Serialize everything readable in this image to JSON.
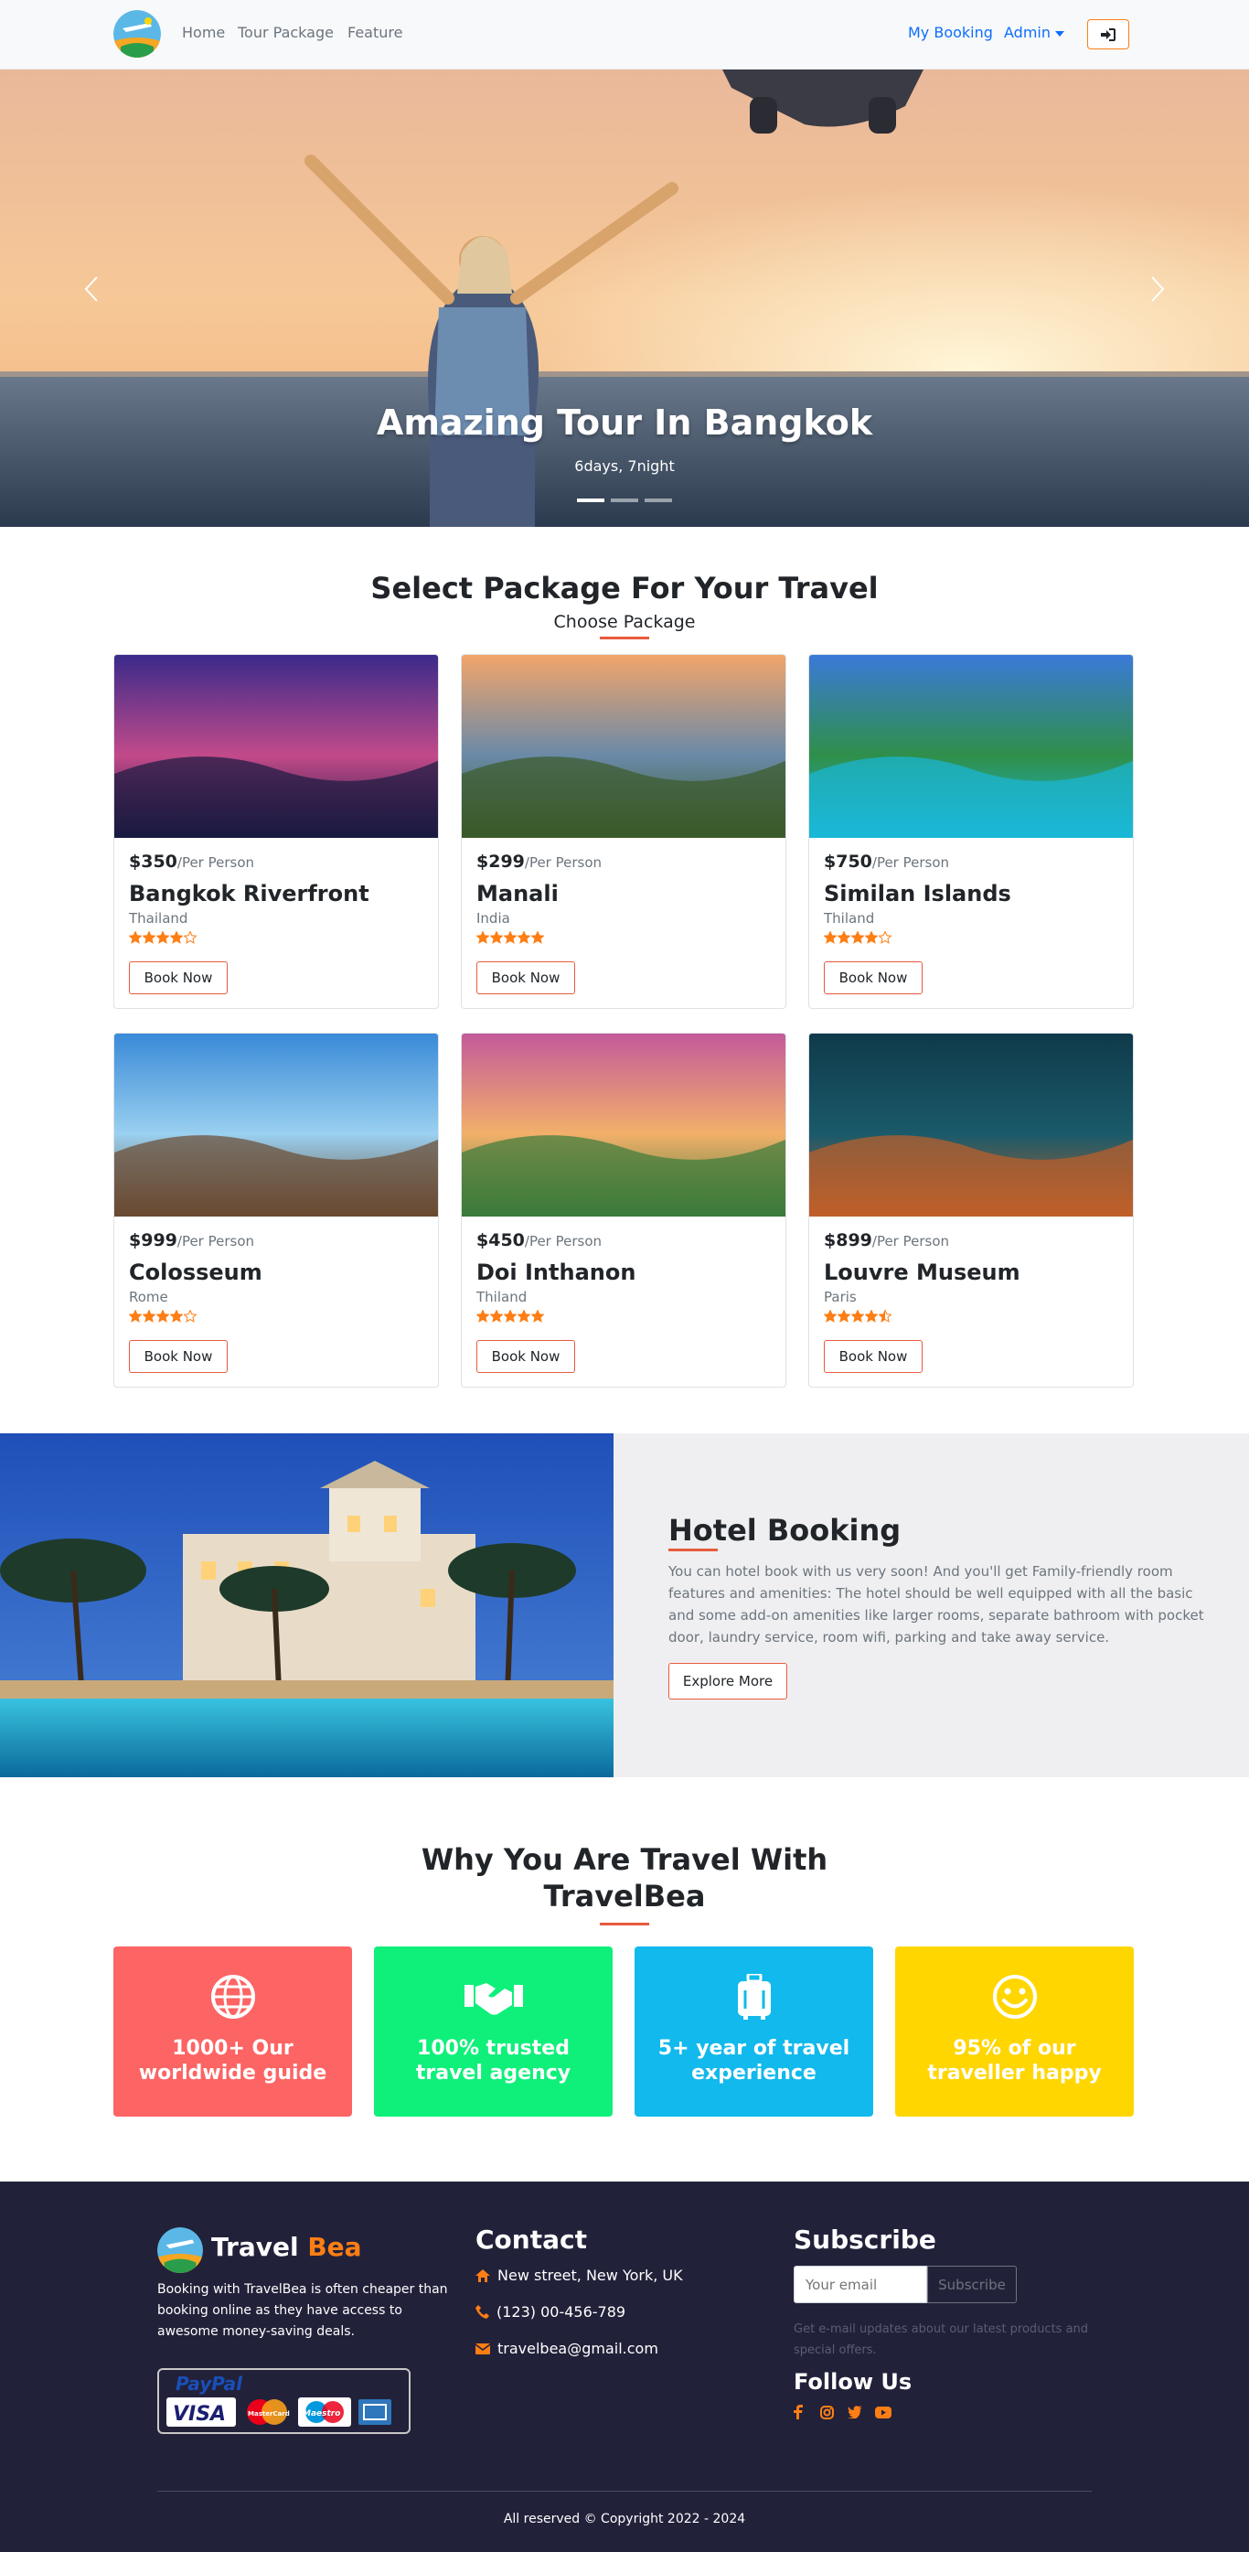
{
  "nav": {
    "links": [
      "Home",
      "Tour Package",
      "Feature"
    ],
    "my_booking": "My Booking",
    "admin": "Admin",
    "login_icon": "sign-in-icon"
  },
  "hero": {
    "title": "Amazing Tour In Bangkok",
    "subtitle": "6days, 7night",
    "slides": 3,
    "active_slide": 1
  },
  "packages": {
    "title": "Select Package For Your Travel",
    "subtitle": "Choose Package",
    "per_person": "/Per Person",
    "book_label": "Book Now",
    "items": [
      {
        "price": "$350",
        "name": "Bangkok Riverfront",
        "country": "Thailand",
        "rating": 4
      },
      {
        "price": "$299",
        "name": "Manali",
        "country": "India",
        "rating": 5
      },
      {
        "price": "$750",
        "name": "Similan Islands",
        "country": "Thiland",
        "rating": 4
      },
      {
        "price": "$999",
        "name": "Colosseum",
        "country": "Rome",
        "rating": 4
      },
      {
        "price": "$450",
        "name": "Doi Inthanon",
        "country": "Thiland",
        "rating": 5
      },
      {
        "price": "$899",
        "name": "Louvre Museum",
        "country": "Paris",
        "rating": 4.5
      }
    ]
  },
  "hotel": {
    "title": "Hotel Booking",
    "text": "You can hotel book with us very soon! And you'll get Family-friendly room features and amenities: The hotel should be well equipped with all the basic and some add-on amenities like larger rooms, separate bathroom with pocket door, laundry service, room wifi, parking and take away service.",
    "button": "Explore More"
  },
  "why": {
    "title_line1": "Why You Are Travel With",
    "title_line2": "TravelBea",
    "features": [
      {
        "text": "1000+ Our worldwide guide",
        "color": "#fd6464",
        "icon": "globe-icon"
      },
      {
        "text": "100% trusted travel agency",
        "color": "#0ef07a",
        "icon": "handshake-icon"
      },
      {
        "text": "5+ year of travel experience",
        "color": "#11b9ec",
        "icon": "suitcase-icon"
      },
      {
        "text": "95% of our traveller happy",
        "color": "#ffd600",
        "icon": "smile-icon"
      }
    ]
  },
  "footer": {
    "brand_a": "Travel",
    "brand_b": "Bea",
    "about": "Booking with TravelBea is often cheaper than booking online as they have access to awesome money-saving deals.",
    "payment": {
      "paypal": "PayPal",
      "visa": "VISA",
      "mastercard": "MasterCard",
      "maestro": "Maestro"
    },
    "contact_title": "Contact",
    "address": "New street, New York, UK",
    "phone": "(123) 00-456-789",
    "email": "travelbea@gmail.com",
    "subscribe_title": "Subscribe",
    "email_placeholder": "Your email",
    "subscribe_btn": "Subscribe",
    "subscribe_note": "Get e-mail updates about our latest products and special offers.",
    "follow_title": "Follow Us",
    "copyright": "All reserved © Copyright 2022 - 2024",
    "accent": "#fd7e14"
  }
}
